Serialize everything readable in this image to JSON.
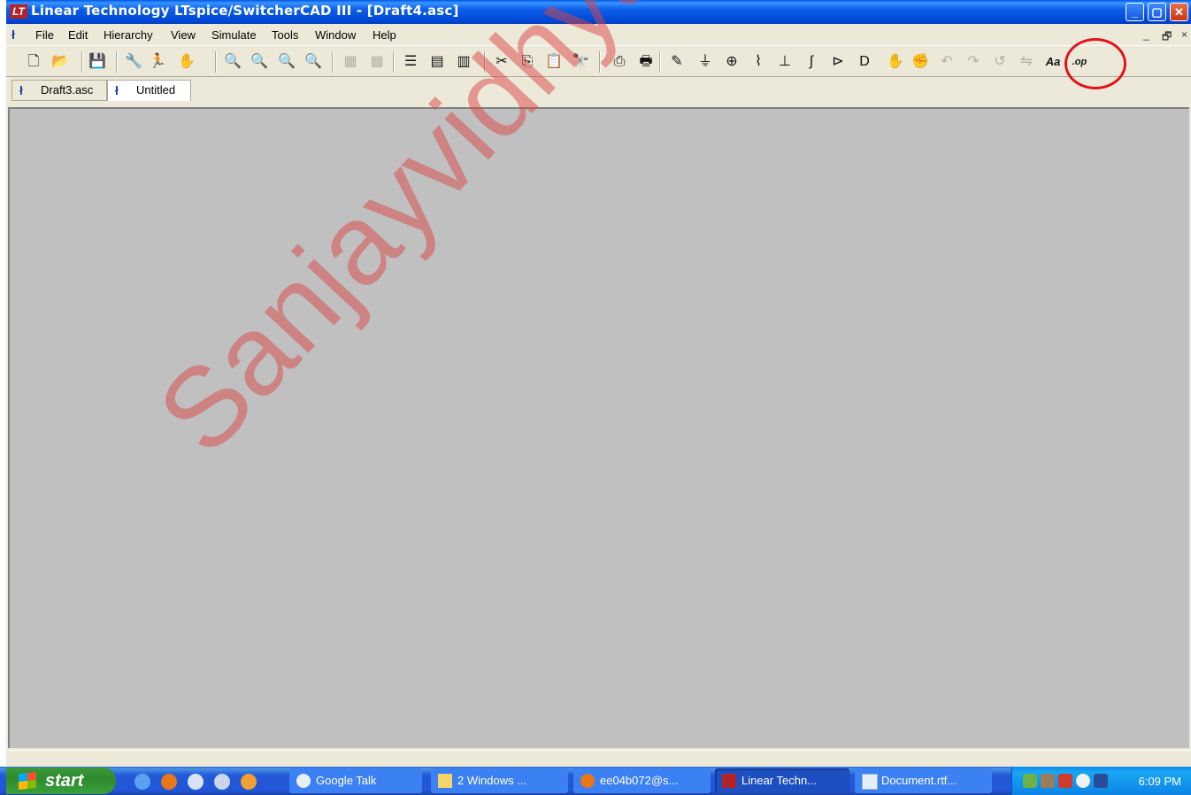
{
  "window": {
    "title": "Linear Technology LTspice/SwitcherCAD III - [Draft4.asc]",
    "app_icon": "LT",
    "controls": [
      "minimize-icon",
      "maximize-icon",
      "close-icon"
    ]
  },
  "menu": {
    "items": [
      "File",
      "Edit",
      "Hierarchy",
      "View",
      "Simulate",
      "Tools",
      "Window",
      "Help"
    ],
    "mdi_minimize": "_",
    "mdi_restore": "🗗",
    "mdi_close": "×"
  },
  "toolbar": {
    "buttons": [
      {
        "name": "new-schematic",
        "glyph": "🗋"
      },
      {
        "name": "open",
        "glyph": "📂"
      },
      {
        "name": "save",
        "glyph": "💾"
      },
      {
        "name": "control-panel",
        "glyph": "🔧"
      },
      {
        "name": "run",
        "glyph": "🏃"
      },
      {
        "name": "halt",
        "glyph": "✋"
      },
      {
        "name": "zoom-in",
        "glyph": "🔍"
      },
      {
        "name": "zoom-area",
        "glyph": "🔍"
      },
      {
        "name": "zoom-out",
        "glyph": "🔍"
      },
      {
        "name": "zoom-fit",
        "glyph": "🔍"
      },
      {
        "name": "autorange-x",
        "glyph": "▦"
      },
      {
        "name": "autorange-y",
        "glyph": "▦"
      },
      {
        "name": "tile",
        "glyph": "☰"
      },
      {
        "name": "cascade",
        "glyph": "▤"
      },
      {
        "name": "close-all",
        "glyph": "▥"
      },
      {
        "name": "cut",
        "glyph": "✂"
      },
      {
        "name": "copy",
        "glyph": "⎘"
      },
      {
        "name": "paste",
        "glyph": "📋"
      },
      {
        "name": "find",
        "glyph": "🔭"
      },
      {
        "name": "print-preview",
        "glyph": "⎙"
      },
      {
        "name": "print",
        "glyph": "🖶"
      },
      {
        "name": "draw-wire",
        "glyph": "✎"
      },
      {
        "name": "ground",
        "glyph": "⏚"
      },
      {
        "name": "label-net",
        "glyph": "⊕"
      },
      {
        "name": "resistor",
        "glyph": "⌇"
      },
      {
        "name": "capacitor",
        "glyph": "⊥"
      },
      {
        "name": "inductor",
        "glyph": "∫"
      },
      {
        "name": "diode",
        "glyph": "⊳"
      },
      {
        "name": "component",
        "glyph": "D"
      },
      {
        "name": "move",
        "glyph": "✋"
      },
      {
        "name": "drag",
        "glyph": "✊"
      },
      {
        "name": "undo",
        "glyph": "↶"
      },
      {
        "name": "redo",
        "glyph": "↷"
      },
      {
        "name": "rotate",
        "glyph": "↺"
      },
      {
        "name": "mirror",
        "glyph": "⇋"
      },
      {
        "name": "text",
        "glyph": "Aa"
      },
      {
        "name": "spice-directive",
        "glyph": ".op"
      }
    ]
  },
  "tabs": [
    {
      "label": "Draft3.asc",
      "active": false
    },
    {
      "label": "Untitled",
      "active": true
    }
  ],
  "watermark": "Sanjayvidhyadharan",
  "taskbar": {
    "start_label": "start",
    "tasks": [
      {
        "label": "Google Talk",
        "active": false
      },
      {
        "label": "2 Windows ...",
        "active": false
      },
      {
        "label": "ee04b072@s...",
        "active": false
      },
      {
        "label": "Linear Techn...",
        "active": true
      },
      {
        "label": "Document.rtf...",
        "active": false
      }
    ],
    "clock": "6:09 PM"
  }
}
